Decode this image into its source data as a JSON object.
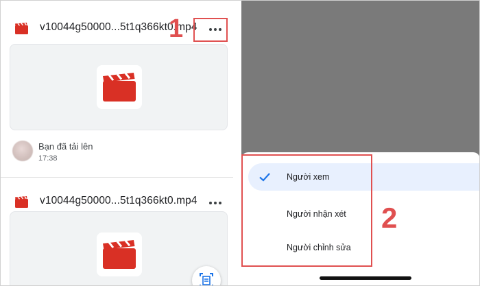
{
  "files": [
    {
      "name": "v10044g50000...5t1q366kt0.mp4",
      "more_icon": "more-horizontal-icon"
    },
    {
      "name": "v10044g50000...5t1q366kt0.mp4",
      "more_icon": "more-horizontal-icon"
    }
  ],
  "uploader": {
    "text": "Bạn đã tải lên",
    "time": "17:38"
  },
  "annotations": {
    "step1": "1",
    "step2": "2",
    "color": "#e05050"
  },
  "access_menu": {
    "options": [
      {
        "label": "Người xem",
        "selected": true
      },
      {
        "label": "Người nhận xét",
        "selected": false
      },
      {
        "label": "Người chỉnh sửa",
        "selected": false
      }
    ]
  },
  "colors": {
    "video_red": "#d93025",
    "accent_blue": "#1a73e8",
    "overlay": "#7a7a7a",
    "selected_bg": "#e8f0fe"
  }
}
